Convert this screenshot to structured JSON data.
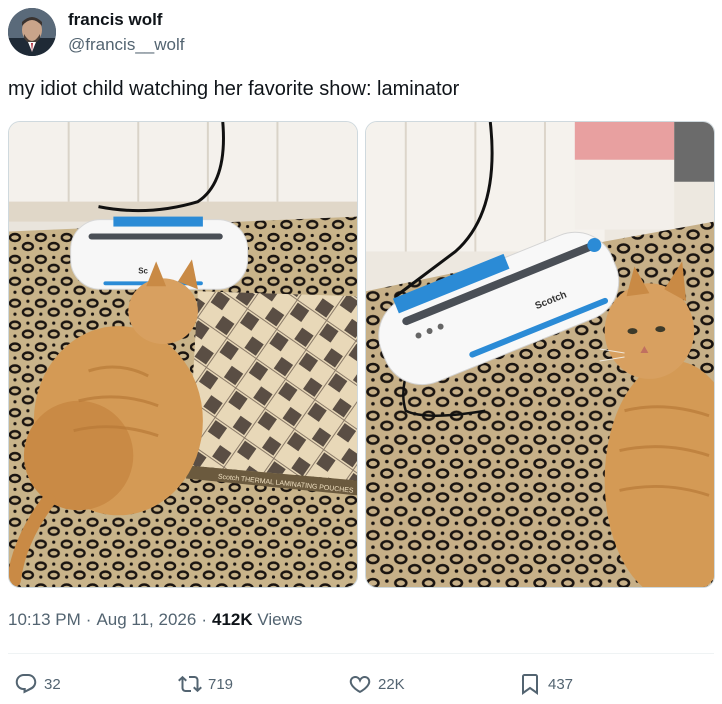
{
  "author": {
    "name": "francis wolf",
    "handle": "@francis__wolf"
  },
  "tweet": {
    "text": "my idiot child watching her favorite show: laminator",
    "time": "10:13 PM",
    "date": "Aug 11, 2026",
    "views_count": "412K",
    "views_label": "Views"
  },
  "media": {
    "left_laminator_brand": "Sc",
    "left_pouch_box_text": "Scotch THERMAL LAMINATING POUCHES",
    "right_laminator_brand": "Scotch"
  },
  "actions": {
    "replies": "32",
    "reposts": "719",
    "likes": "22K",
    "bookmarks": "437"
  },
  "colors": {
    "text_primary": "#0f1419",
    "text_secondary": "#536471",
    "divider": "#eff3f4"
  }
}
